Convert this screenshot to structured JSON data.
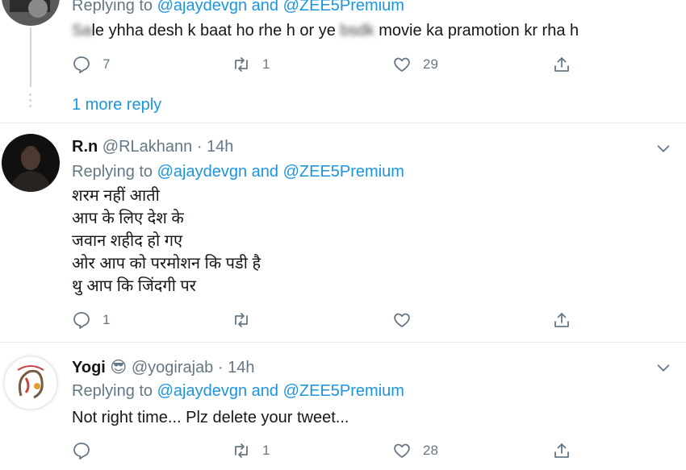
{
  "tweet1": {
    "replying_prefix": "Replying to",
    "mention1": "@ajaydevgn",
    "and": "and",
    "mention2": "@ZEE5Premium",
    "text_blur1": "Sa",
    "text_part1": "le yhha desh k baat ho rhe h or ye",
    "text_blur2": "bsdk",
    "text_part2": "movie ka pramotion kr rha h",
    "reply_count": "7",
    "retweet_count": "1",
    "like_count": "29",
    "more_reply": "1 more reply"
  },
  "tweet2": {
    "name": "R.n",
    "handle": "@RLakhann",
    "time": "· 14h",
    "replying_prefix": "Replying to",
    "mention1": "@ajaydevgn",
    "and": "and",
    "mention2": "@ZEE5Premium",
    "lines": [
      "शरम नहीं आती",
      "आप के लिए देश के",
      "जवान शहीद हो गए",
      "ओर आप को परमोशन कि पडी है",
      "थु आप कि जिंदगी पर"
    ],
    "reply_count": "1",
    "retweet_count": "",
    "like_count": ""
  },
  "tweet3": {
    "name": "Yogi",
    "emoji": "😎",
    "handle": "@yogirajab",
    "time": "· 14h",
    "replying_prefix": "Replying to",
    "mention1": "@ajaydevgn",
    "and": "and",
    "mention2": "@ZEE5Premium",
    "text": "Not right time... Plz delete your tweet...",
    "reply_count": "",
    "retweet_count": "1",
    "like_count": "28"
  },
  "icons": {
    "reply": "reply-icon",
    "retweet": "retweet-icon",
    "like": "heart-icon",
    "share": "share-icon",
    "caret": "chevron-down-icon"
  },
  "colors": {
    "link": "#1b95e0",
    "muted": "#657786",
    "text": "#14171a",
    "divider": "#e6ecf0"
  }
}
